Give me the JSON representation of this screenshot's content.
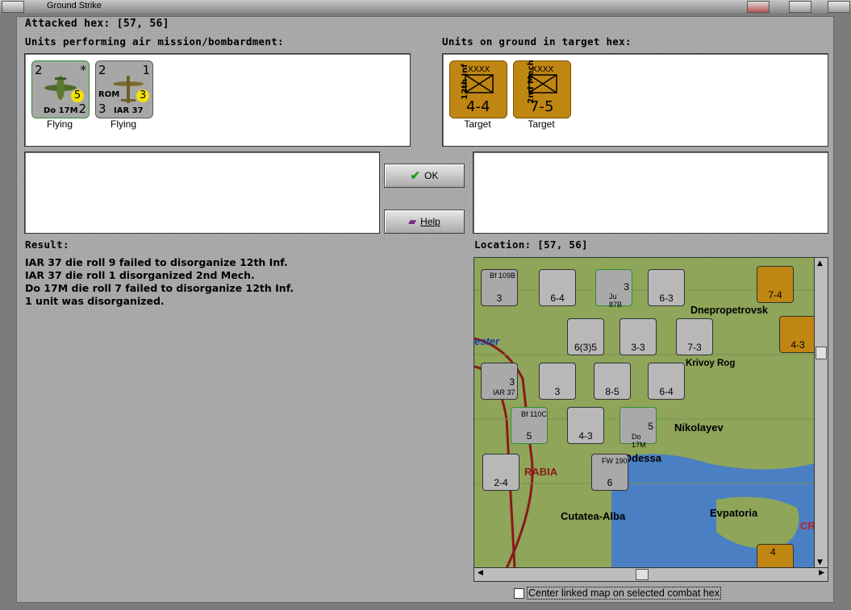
{
  "window": {
    "title": "Ground Strike"
  },
  "header": {
    "attacked_hex": "Attacked hex:  [57, 56]"
  },
  "air_units": {
    "label": "Units performing air mission/bombardment:",
    "items": [
      {
        "top_left": "2",
        "top_right": "*",
        "name": "Do 17M",
        "bottom_right": "2",
        "circle": "5",
        "status": "Flying"
      },
      {
        "top_left": "2",
        "top_right": "1",
        "nation": "ROM",
        "name": "IAR 37",
        "bottom_left": "3",
        "circle": "3",
        "status": "Flying"
      }
    ]
  },
  "ground_units": {
    "label": "Units on ground in target hex:",
    "items": [
      {
        "side": "12th Inf",
        "size": "XXXX",
        "value": "4-4",
        "status": "Target"
      },
      {
        "side": "2nd Mech",
        "size": "XXXX",
        "value": "7-5",
        "status": "Target"
      }
    ]
  },
  "buttons": {
    "ok": "OK",
    "help": "Help"
  },
  "result": {
    "label": "Result:",
    "lines": [
      "IAR 37 die roll 9 failed to disorganize 12th Inf.",
      "IAR 37 die roll 1 disorganized 2nd Mech.",
      "Do 17M die roll 7 failed to disorganize 12th Inf.",
      "1 unit was disorganized."
    ]
  },
  "location": {
    "label": "Location:  [57, 56]",
    "cities": [
      "Dnepropetrovsk",
      "Krivoy Rog",
      "Nikolayev",
      "Odessa",
      "Cutatea-Alba",
      "Evpatoria",
      "ester",
      "RABIA",
      "CR"
    ],
    "counters": [
      {
        "name": "Bf 109B",
        "v": "3"
      },
      {
        "name": "",
        "v": "6-4"
      },
      {
        "name": "Ju 87B",
        "v": "3"
      },
      {
        "name": "",
        "v": "6-3"
      },
      {
        "name": "",
        "v": "7-4"
      },
      {
        "name": "",
        "v": "6(3)5"
      },
      {
        "name": "",
        "v": "3-3"
      },
      {
        "name": "",
        "v": "7-3"
      },
      {
        "name": "",
        "v": "4-3"
      },
      {
        "name": "IAR 37",
        "v": "3"
      },
      {
        "name": "",
        "v": "3"
      },
      {
        "name": "",
        "v": "8-5"
      },
      {
        "name": "",
        "v": "6-4"
      },
      {
        "name": "Bf 110C",
        "v": "5"
      },
      {
        "name": "",
        "v": "4-3"
      },
      {
        "name": "Do 17M",
        "v": "5"
      },
      {
        "name": "",
        "v": "2-4"
      },
      {
        "name": "FW 190",
        "v": "6"
      },
      {
        "name": "",
        "v": "4"
      }
    ]
  },
  "options": {
    "center_map": "Center linked map on selected combat hex"
  }
}
